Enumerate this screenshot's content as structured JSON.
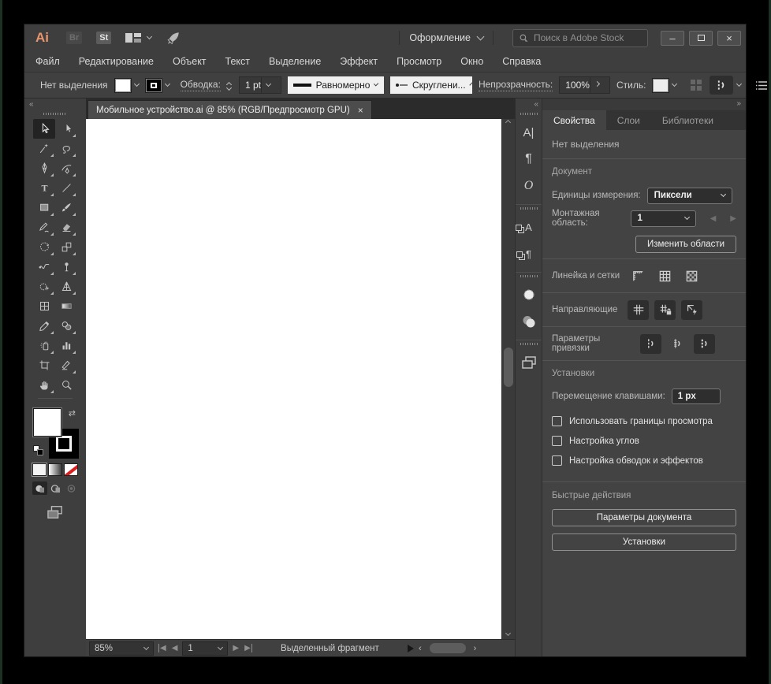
{
  "titlebar": {
    "app_icon": "Ai",
    "bridge_icon": "Br",
    "stock_icon": "St",
    "workspace_label": "Оформление",
    "search_placeholder": "Поиск в Adobe Stock",
    "minimize_glyph": "–",
    "close_glyph": "×"
  },
  "menubar": {
    "items": [
      "Файл",
      "Редактирование",
      "Объект",
      "Текст",
      "Выделение",
      "Эффект",
      "Просмотр",
      "Окно",
      "Справка"
    ]
  },
  "control_bar": {
    "selection_status": "Нет выделения",
    "stroke_label": "Обводка:",
    "stroke_width_value": "1 pt",
    "stroke_profile_value": "Равномерно",
    "brush_definition_value": "Скруглени...",
    "opacity_label": "Непрозрачность:",
    "opacity_value": "100%",
    "style_label": "Стиль:"
  },
  "document_tab": {
    "title": "Мобильное устройство.ai @ 85% (RGB/Предпросмотр GPU)",
    "close_glyph": "×"
  },
  "toolbar_tools": [
    "selection",
    "direct-selection",
    "magic-wand",
    "lasso",
    "pen",
    "curvature",
    "type",
    "line-segment",
    "rectangle",
    "paintbrush",
    "shaper",
    "eraser",
    "rotate",
    "scale",
    "width",
    "puppet-warp",
    "shape-builder",
    "perspective-grid",
    "mesh",
    "gradient",
    "eyedropper",
    "blend",
    "symbol-sprayer",
    "column-graph",
    "artboard",
    "slice",
    "hand",
    "zoom"
  ],
  "dock": {
    "panels": [
      "character",
      "paragraph",
      "opentype",
      "character-styles",
      "paragraph-styles",
      "dashed-circle",
      "overlapping-circles",
      "overlapping-rectangles"
    ],
    "character_glyph": "A|",
    "paragraph_glyph": "¶",
    "opentype_glyph": "O",
    "character_styles_glyph": "A",
    "paragraph_styles_glyph": "¶"
  },
  "properties_panel": {
    "tabs": [
      "Свойства",
      "Слои",
      "Библиотеки"
    ],
    "active_tab": "Свойства",
    "no_selection": "Нет выделения",
    "document": {
      "title": "Документ",
      "units_label": "Единицы измерения:",
      "units_value": "Пиксели",
      "artboard_label": "Монтажная область:",
      "artboard_value": "1",
      "edit_artboards_button": "Изменить области",
      "rulers_grids_label": "Линейка и сетки",
      "guides_label": "Направляющие",
      "snap_label": "Параметры привязки"
    },
    "preferences": {
      "title": "Установки",
      "keyboard_increment_label": "Перемещение клавишами:",
      "keyboard_increment_value": "1 px",
      "checkboxes": [
        "Использовать границы просмотра",
        "Настройка углов",
        "Настройка обводок и эффектов"
      ]
    },
    "quick_actions": {
      "title": "Быстрые действия",
      "document_setup_button": "Параметры документа",
      "preferences_button": "Установки"
    }
  },
  "status_bar": {
    "zoom_value": "85%",
    "artboard_value": "1",
    "status_text": "Выделенный фрагмент"
  },
  "glyphs": {
    "collapse_left": "«",
    "collapse_right": "»",
    "prev": "◀",
    "next": "▶",
    "swap": "⇄"
  },
  "colors": {
    "accent_logo": "#E8956C",
    "chrome": "#3E3E3E",
    "panel": "#434343",
    "canvas": "#FFFFFF",
    "none_slash": "#D91E1E"
  }
}
